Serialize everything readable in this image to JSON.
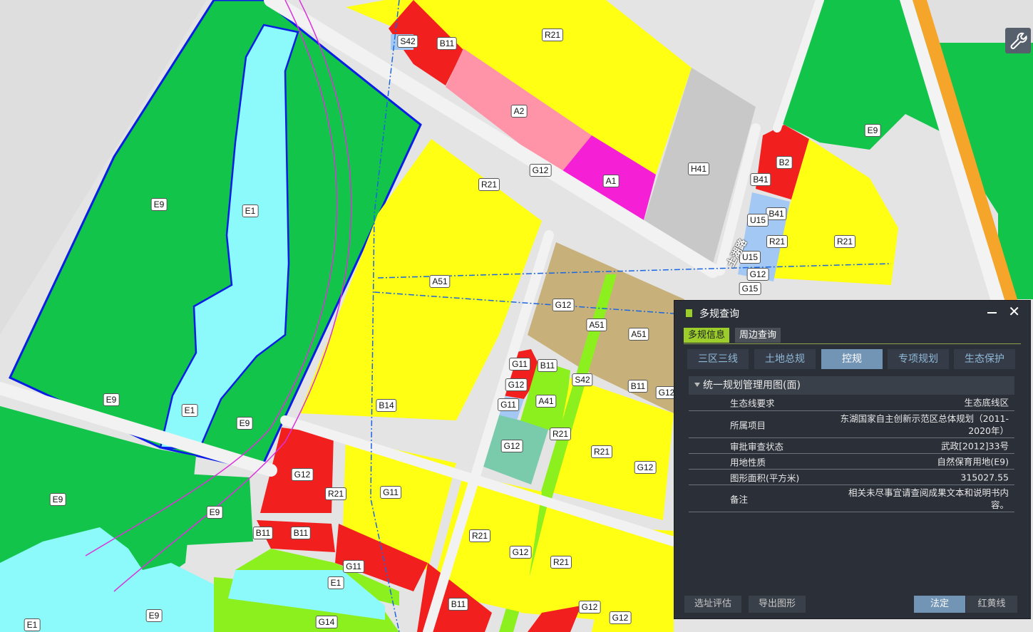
{
  "colors": {
    "E9": "#12c449",
    "E1": "#8cfafa",
    "R21": "#ffff14",
    "B11": "#f21f1f",
    "A2": "#ff94a8",
    "A1": "#f51fd6",
    "H41": "#c8c8c8",
    "A51": "#c8b07a",
    "A41": "#7acbab",
    "S42": "#a4c8f4",
    "G11": "#8cf01e",
    "road": "#f2f2f2",
    "panel_bg": "#2a2f38",
    "accent": "#9ccd2a",
    "ecoline": "#0a1de6"
  },
  "map": {
    "labels": [
      "E9",
      "E1",
      "E9",
      "E1",
      "E9",
      "E9",
      "E9",
      "E9",
      "E1",
      "S42",
      "B11",
      "R21",
      "A2",
      "G12",
      "A1",
      "H41",
      "E9",
      "B2",
      "B41",
      "B41",
      "U15",
      "U15",
      "R21",
      "R21",
      "G12",
      "G15",
      "R21",
      "A51",
      "G12",
      "A51",
      "A51",
      "B11",
      "G11",
      "B11",
      "G12",
      "S42",
      "G11",
      "A41",
      "G12",
      "R21",
      "R21",
      "B14",
      "G12",
      "R21",
      "G11",
      "B11",
      "B11",
      "G11",
      "R21",
      "G12",
      "R21",
      "E1",
      "B11",
      "G14",
      "G12",
      "G12",
      "G12",
      "G12"
    ],
    "road_name": "土湖路",
    "tool_icon": "wrench-icon"
  },
  "panel": {
    "title": "多规查询",
    "tabs": [
      "多规信息",
      "周边查询"
    ],
    "subtabs": [
      "三区三线",
      "土地总规",
      "控规",
      "专项规划",
      "生态保护"
    ],
    "section": "统一规划管理用图(面)",
    "rows": [
      {
        "k": "生态线要求",
        "v": "生态底线区"
      },
      {
        "k": "所属项目",
        "v": "东湖国家自主创新示范区总体规划（2011-2020年）"
      },
      {
        "k": "审批审查状态",
        "v": "武政[2012]33号"
      },
      {
        "k": "用地性质",
        "v": "自然保育用地(E9)"
      },
      {
        "k": "图形面积(平方米)",
        "v": "315027.55"
      },
      {
        "k": "备注",
        "v": "相关未尽事宜请查阅成果文本和说明书内容。"
      }
    ],
    "buttons": [
      "选址评估",
      "导出图形"
    ],
    "toggle": [
      "法定",
      "红黄线"
    ]
  }
}
